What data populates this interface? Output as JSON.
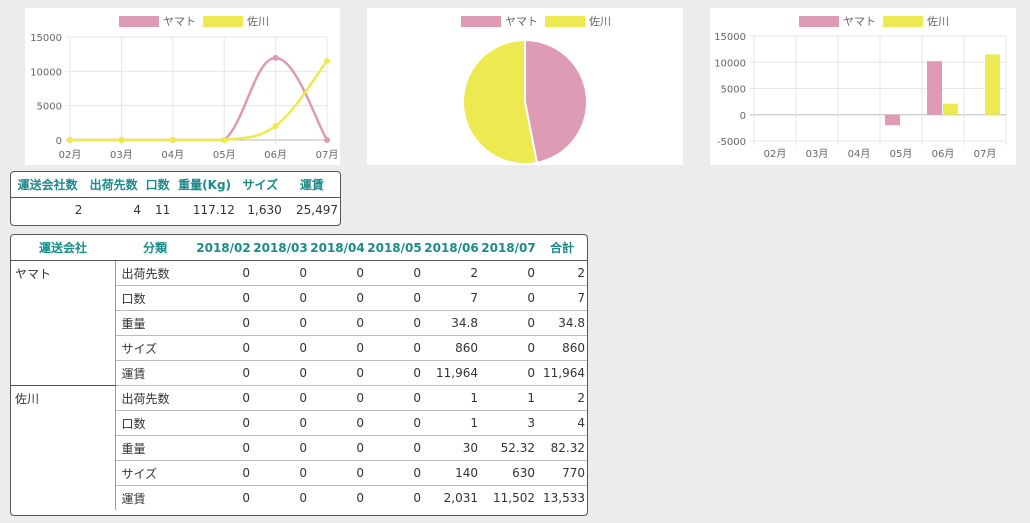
{
  "legend": {
    "yamato": "ヤマト",
    "sagawa": "佐川"
  },
  "colors": {
    "yamato": "#dd9bb5",
    "sagawa": "#ede950"
  },
  "chart_data": [
    {
      "type": "line",
      "categories": [
        "02月",
        "03月",
        "04月",
        "05月",
        "06月",
        "07月"
      ],
      "series": [
        {
          "name": "ヤマト",
          "values": [
            0,
            0,
            0,
            0,
            11964,
            0
          ]
        },
        {
          "name": "佐川",
          "values": [
            0,
            0,
            0,
            0,
            2031,
            11502
          ]
        }
      ],
      "ylim": [
        0,
        15000
      ],
      "yticks": [
        0,
        5000,
        10000,
        15000
      ],
      "grid": true,
      "legend": "top"
    },
    {
      "type": "pie",
      "categories": [
        "ヤマト",
        "佐川"
      ],
      "values": [
        11964,
        13533
      ],
      "legend": "top"
    },
    {
      "type": "bar",
      "categories": [
        "02月",
        "03月",
        "04月",
        "05月",
        "06月",
        "07月"
      ],
      "series": [
        {
          "name": "ヤマト",
          "values": [
            0,
            0,
            0,
            -2000,
            10200,
            0
          ]
        },
        {
          "name": "佐川",
          "values": [
            0,
            0,
            0,
            0,
            2100,
            11502
          ]
        }
      ],
      "ylim": [
        -5000,
        15000
      ],
      "yticks": [
        -5000,
        0,
        5000,
        10000,
        15000
      ],
      "grid": true,
      "legend": "top"
    }
  ],
  "summary": {
    "headers": [
      "運送会社数",
      "出荷先数",
      "口数",
      "重量(Kg)",
      "サイズ",
      "運賃"
    ],
    "values": [
      "2",
      "4",
      "11",
      "117.12",
      "1,630",
      "25,497"
    ]
  },
  "detail": {
    "headers": [
      "運送会社",
      "分類",
      "2018/02",
      "2018/03",
      "2018/04",
      "2018/05",
      "2018/06",
      "2018/07",
      "合計"
    ],
    "groups": [
      {
        "carrier": "ヤマト",
        "rows": [
          [
            "出荷先数",
            "0",
            "0",
            "0",
            "0",
            "2",
            "0",
            "2"
          ],
          [
            "口数",
            "0",
            "0",
            "0",
            "0",
            "7",
            "0",
            "7"
          ],
          [
            "重量",
            "0",
            "0",
            "0",
            "0",
            "34.8",
            "0",
            "34.8"
          ],
          [
            "サイズ",
            "0",
            "0",
            "0",
            "0",
            "860",
            "0",
            "860"
          ],
          [
            "運賃",
            "0",
            "0",
            "0",
            "0",
            "11,964",
            "0",
            "11,964"
          ]
        ]
      },
      {
        "carrier": "佐川",
        "rows": [
          [
            "出荷先数",
            "0",
            "0",
            "0",
            "0",
            "1",
            "1",
            "2"
          ],
          [
            "口数",
            "0",
            "0",
            "0",
            "0",
            "1",
            "3",
            "4"
          ],
          [
            "重量",
            "0",
            "0",
            "0",
            "0",
            "30",
            "52.32",
            "82.32"
          ],
          [
            "サイズ",
            "0",
            "0",
            "0",
            "0",
            "140",
            "630",
            "770"
          ],
          [
            "運賃",
            "0",
            "0",
            "0",
            "0",
            "2,031",
            "11,502",
            "13,533"
          ]
        ]
      }
    ]
  }
}
